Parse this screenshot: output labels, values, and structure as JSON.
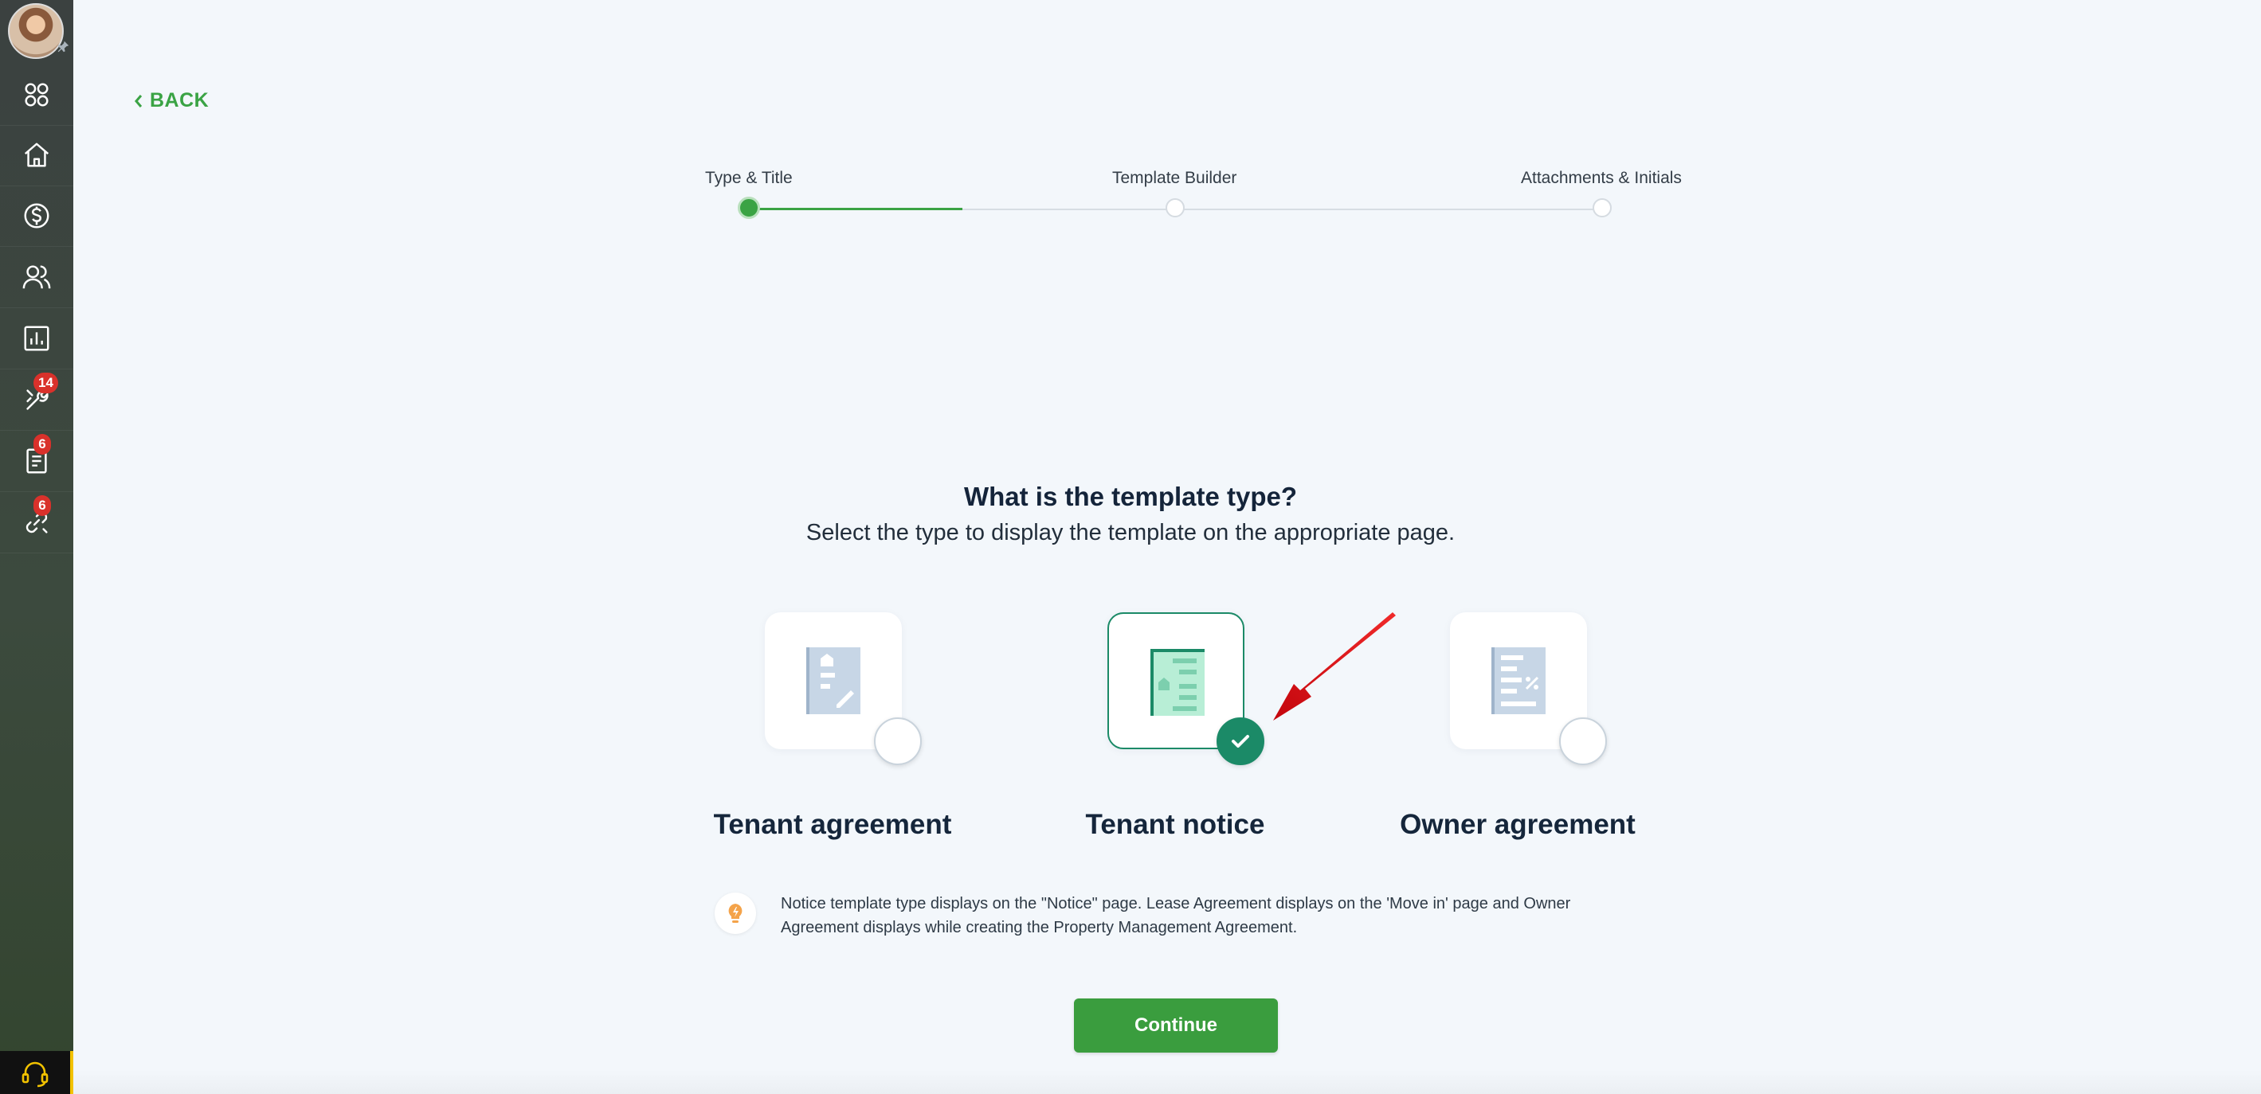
{
  "sidebar": {
    "items": [
      {
        "icon": "apps-grid-icon"
      },
      {
        "icon": "home-icon"
      },
      {
        "icon": "dollar-icon"
      },
      {
        "icon": "people-icon"
      },
      {
        "icon": "report-chart-icon"
      },
      {
        "icon": "tools-icon",
        "badge": "14"
      },
      {
        "icon": "document-icon",
        "badge": "6"
      },
      {
        "icon": "link-icon",
        "badge": "6"
      }
    ],
    "support_icon": "headset-icon"
  },
  "back": {
    "label": "BACK"
  },
  "stepper": {
    "steps": [
      {
        "label": "Type & Title",
        "state": "active"
      },
      {
        "label": "Template Builder",
        "state": "pending"
      },
      {
        "label": "Attachments & Initials",
        "state": "pending"
      }
    ]
  },
  "question": {
    "title": "What is the template type?",
    "subtitle": "Select the type to display the template on the appropriate page."
  },
  "options": [
    {
      "label": "Tenant agreement",
      "selected": false
    },
    {
      "label": "Tenant notice",
      "selected": true
    },
    {
      "label": "Owner agreement",
      "selected": false
    }
  ],
  "tip": {
    "text": "Notice template type displays on the \"Notice\" page. Lease Agreement displays on the 'Move in' page and Owner Agreement displays while creating the Property Management Agreement."
  },
  "continue": {
    "label": "Continue"
  },
  "colors": {
    "brand_green": "#3a9d3e",
    "selected_teal": "#1b8a67",
    "badge_red": "#d9312b",
    "annotation_arrow": "#e0141b"
  }
}
